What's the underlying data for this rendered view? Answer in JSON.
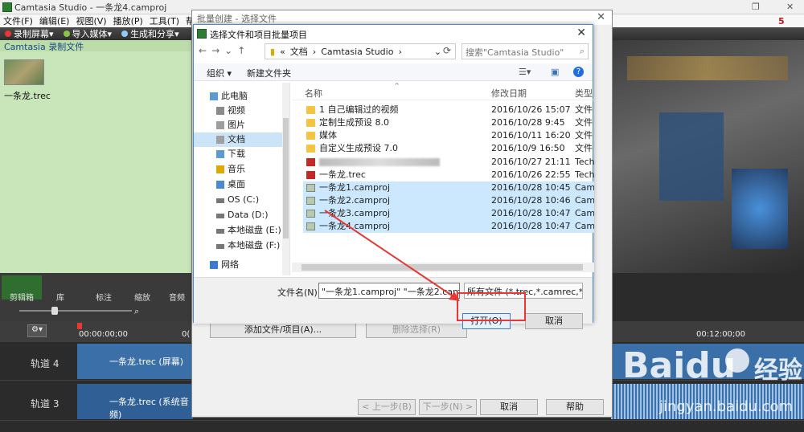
{
  "window": {
    "title": "Camtasia Studio - 一条龙4.camproj",
    "badge": "5"
  },
  "menu": [
    "文件(F)",
    "编辑(E)",
    "视图(V)",
    "播放(P)",
    "工具(T)",
    "帮助(H)"
  ],
  "toolbar": {
    "record": "录制屏幕",
    "import": "导入媒体",
    "produce": "生成和分享"
  },
  "clipbin": {
    "header": "Camtasia 录制文件",
    "clip_name": "一条龙.trec"
  },
  "left_tabs": [
    "剪辑箱",
    "库",
    "标注",
    "缩放",
    "音频"
  ],
  "timeline": {
    "t0": "00:00:00;00",
    "t1": "00:12:00;00",
    "t_mid": "0("
  },
  "tracks": [
    {
      "label": "轨道 4",
      "clip": "一条龙.trec (屏幕)"
    },
    {
      "label": "轨道 3",
      "clip": "一条龙.trec (系统音频)"
    }
  ],
  "batch": {
    "title": "批量创建 - 选择文件",
    "add": "添加文件/项目(A)...",
    "remove": "删除选择(R)",
    "prev": "< 上一步(B)",
    "next": "下一步(N) >",
    "cancel": "取消",
    "help": "帮助"
  },
  "dialog": {
    "title": "选择文件和项目批量项目",
    "breadcrumb": [
      "文档",
      "Camtasia Studio"
    ],
    "search_placeholder": "搜索\"Camtasia Studio\"",
    "organize": "组织 ▾",
    "new_folder": "新建文件夹",
    "columns": {
      "name": "名称",
      "date": "修改日期",
      "type": "类型"
    },
    "nav": [
      {
        "label": "此电脑",
        "icon": "computer-icon"
      },
      {
        "label": "视频",
        "icon": "video-folder-icon"
      },
      {
        "label": "图片",
        "icon": "picture-folder-icon"
      },
      {
        "label": "文档",
        "icon": "document-folder-icon",
        "selected": true
      },
      {
        "label": "下载",
        "icon": "download-folder-icon"
      },
      {
        "label": "音乐",
        "icon": "music-folder-icon"
      },
      {
        "label": "桌面",
        "icon": "desktop-folder-icon"
      },
      {
        "label": "OS (C:)",
        "icon": "drive-icon"
      },
      {
        "label": "Data (D:)",
        "icon": "drive-icon"
      },
      {
        "label": "本地磁盘 (E:)",
        "icon": "drive-icon"
      },
      {
        "label": "本地磁盘 (F:)",
        "icon": "drive-icon"
      },
      {
        "label": "网络",
        "icon": "network-icon"
      }
    ],
    "files": [
      {
        "name": "1 自己编辑过的视频",
        "date": "2016/10/26 15:07",
        "type": "文件",
        "kind": "folder"
      },
      {
        "name": "定制生成预设 8.0",
        "date": "2016/10/28 9:45",
        "type": "文件",
        "kind": "folder"
      },
      {
        "name": "媒体",
        "date": "2016/10/11 16:20",
        "type": "文件",
        "kind": "folder"
      },
      {
        "name": "自定义生成预设 7.0",
        "date": "2016/10/9 16:50",
        "type": "文件",
        "kind": "folder"
      },
      {
        "name": "",
        "date": "2016/10/27 21:11",
        "type": "Tech",
        "kind": "redfile"
      },
      {
        "name": "一条龙.trec",
        "date": "2016/10/26 22:55",
        "type": "Tech",
        "kind": "redfile"
      },
      {
        "name": "一条龙1.camproj",
        "date": "2016/10/28 10:45",
        "type": "Cam",
        "kind": "proj",
        "selected": true
      },
      {
        "name": "一条龙2.camproj",
        "date": "2016/10/28 10:46",
        "type": "Cam",
        "kind": "proj",
        "selected": true
      },
      {
        "name": "一条龙3.camproj",
        "date": "2016/10/28 10:47",
        "type": "Cam",
        "kind": "proj",
        "selected": true
      },
      {
        "name": "一条龙4.camproj",
        "date": "2016/10/28 10:47",
        "type": "Cam",
        "kind": "proj",
        "selected": true
      }
    ],
    "filename_label": "文件名(N):",
    "filename_value": "\"一条龙1.camproj\" \"一条龙2.campro",
    "filetype": "所有文件 (*.trec,*.camrec,*.avi,",
    "open": "打开(O)",
    "cancel": "取消"
  },
  "watermark": {
    "brand": "Baidu",
    "sub": "经验",
    "url": "jingyan.baidu.com"
  },
  "colors": {
    "accent": "#2e7d32",
    "selection": "#cce8ff",
    "highlight": "#e53935"
  }
}
